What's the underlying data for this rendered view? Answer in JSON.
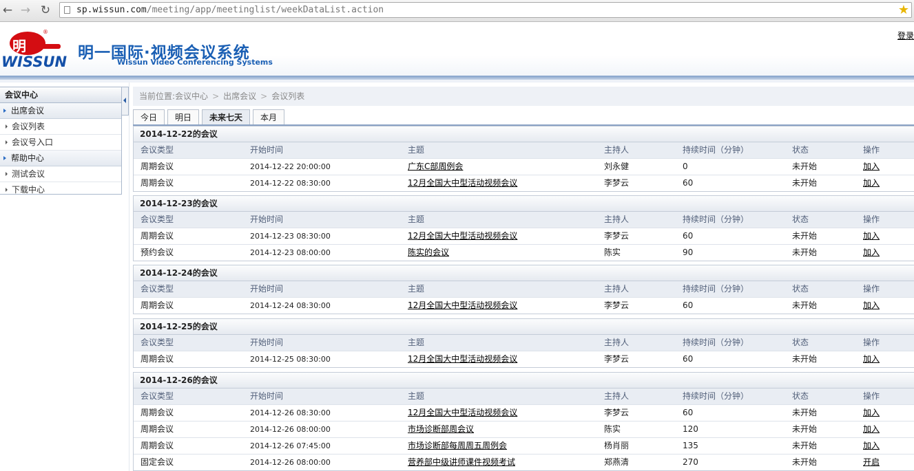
{
  "browser": {
    "url_host": "sp.wissun.com",
    "url_path": "/meeting/app/meetinglist/weekDataList.action"
  },
  "header": {
    "logo_char": "明",
    "logo_word": "WISSUN",
    "reg_mark": "®",
    "title": "明一国际·视频会议系统",
    "subtitle": "Wissun Video Conferencing Systems",
    "login": "登录"
  },
  "sidebar": {
    "title": "会议中心",
    "items": [
      {
        "label": "出席会议",
        "type": "group"
      },
      {
        "label": "会议列表",
        "type": "item"
      },
      {
        "label": "会议号入口",
        "type": "item"
      },
      {
        "label": "帮助中心",
        "type": "group"
      },
      {
        "label": "测试会议",
        "type": "item"
      },
      {
        "label": "下载中心",
        "type": "item"
      }
    ]
  },
  "breadcrumb": {
    "prefix": "当前位置:",
    "parts": [
      "会议中心",
      "出席会议",
      "会议列表"
    ],
    "separator": ">"
  },
  "tabs": [
    {
      "label": "今日",
      "active": false
    },
    {
      "label": "明日",
      "active": false
    },
    {
      "label": "未来七天",
      "active": true
    },
    {
      "label": "本月",
      "active": false
    }
  ],
  "columns": [
    "会议类型",
    "开始时间",
    "主题",
    "主持人",
    "持续时间（分钟）",
    "状态",
    "操作"
  ],
  "days": [
    {
      "title": "2014-12-22的会议",
      "rows": [
        [
          "周期会议",
          "2014-12-22 20:00:00",
          "广东C部周例会",
          "刘永健",
          "0",
          "未开始",
          "加入"
        ],
        [
          "周期会议",
          "2014-12-22 08:30:00",
          "12月全国大中型活动视频会议",
          "李梦云",
          "60",
          "未开始",
          "加入"
        ]
      ]
    },
    {
      "title": "2014-12-23的会议",
      "rows": [
        [
          "周期会议",
          "2014-12-23 08:30:00",
          "12月全国大中型活动视频会议",
          "李梦云",
          "60",
          "未开始",
          "加入"
        ],
        [
          "预约会议",
          "2014-12-23 08:00:00",
          "陈实的会议",
          "陈实",
          "90",
          "未开始",
          "加入"
        ]
      ]
    },
    {
      "title": "2014-12-24的会议",
      "rows": [
        [
          "周期会议",
          "2014-12-24 08:30:00",
          "12月全国大中型活动视频会议",
          "李梦云",
          "60",
          "未开始",
          "加入"
        ]
      ]
    },
    {
      "title": "2014-12-25的会议",
      "rows": [
        [
          "周期会议",
          "2014-12-25 08:30:00",
          "12月全国大中型活动视频会议",
          "李梦云",
          "60",
          "未开始",
          "加入"
        ]
      ]
    },
    {
      "title": "2014-12-26的会议",
      "rows": [
        [
          "周期会议",
          "2014-12-26 08:30:00",
          "12月全国大中型活动视频会议",
          "李梦云",
          "60",
          "未开始",
          "加入"
        ],
        [
          "周期会议",
          "2014-12-26 08:00:00",
          "市场诊断部周会议",
          "陈实",
          "120",
          "未开始",
          "加入"
        ],
        [
          "周期会议",
          "2014-12-26 07:45:00",
          "市场诊断部每周周五周例会",
          "杨肖丽",
          "135",
          "未开始",
          "加入"
        ],
        [
          "固定会议",
          "2014-12-26 08:00:00",
          "营养部中级讲师课件视频考试",
          "郑燕清",
          "270",
          "未开始",
          "开启"
        ]
      ]
    }
  ]
}
